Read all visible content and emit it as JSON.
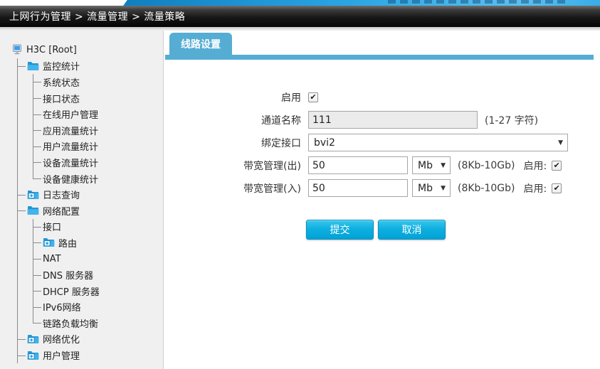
{
  "top": {
    "breadcrumb": "上网行为管理 > 流量管理 > 流量策略"
  },
  "sidebar": {
    "root": {
      "label": "H3C [Root]",
      "icon": "computer-icon"
    },
    "tree": [
      {
        "label": "监控统计",
        "icon": "folder-open-icon",
        "children": [
          {
            "label": "系统状态"
          },
          {
            "label": "接口状态"
          },
          {
            "label": "在线用户管理"
          },
          {
            "label": "应用流量统计"
          },
          {
            "label": "用户流量统计"
          },
          {
            "label": "设备流量统计"
          },
          {
            "label": "设备健康统计"
          }
        ]
      },
      {
        "label": "日志查询",
        "icon": "folder-plus-icon"
      },
      {
        "label": "网络配置",
        "icon": "folder-open-icon",
        "children": [
          {
            "label": "接口"
          },
          {
            "label": "路由",
            "icon": "folder-plus-icon"
          },
          {
            "label": "NAT"
          },
          {
            "label": "DNS 服务器"
          },
          {
            "label": "DHCP 服务器"
          },
          {
            "label": "IPv6网络"
          },
          {
            "label": "链路负载均衡"
          }
        ]
      },
      {
        "label": "网络优化",
        "icon": "folder-plus-icon"
      },
      {
        "label": "用户管理",
        "icon": "folder-plus-icon"
      }
    ]
  },
  "tab": {
    "label": "线路设置"
  },
  "form": {
    "enable": {
      "label": "启用",
      "checked": true
    },
    "channel_name": {
      "label": "通道名称",
      "value": "111",
      "hint": "(1-27 字符)"
    },
    "bind_interface": {
      "label": "绑定接口",
      "value": "bvi2"
    },
    "bandwidth_out": {
      "label": "带宽管理(出)",
      "value": "50",
      "unit": "Mb",
      "range_hint": "(8Kb-10Gb)",
      "enable_label": "启用:",
      "enabled": true
    },
    "bandwidth_in": {
      "label": "带宽管理(入)",
      "value": "50",
      "unit": "Mb",
      "range_hint": "(8Kb-10Gb)",
      "enable_label": "启用:",
      "enabled": true
    },
    "submit_label": "提交",
    "cancel_label": "取消"
  },
  "glyphs": {
    "check": "✔",
    "dropdown_arrow": "▼"
  },
  "colors": {
    "accent_blue": "#55add3",
    "button_blue": "#0fb0e0",
    "strip_blue": "#2aa5e4",
    "bar_black": "#171717"
  }
}
